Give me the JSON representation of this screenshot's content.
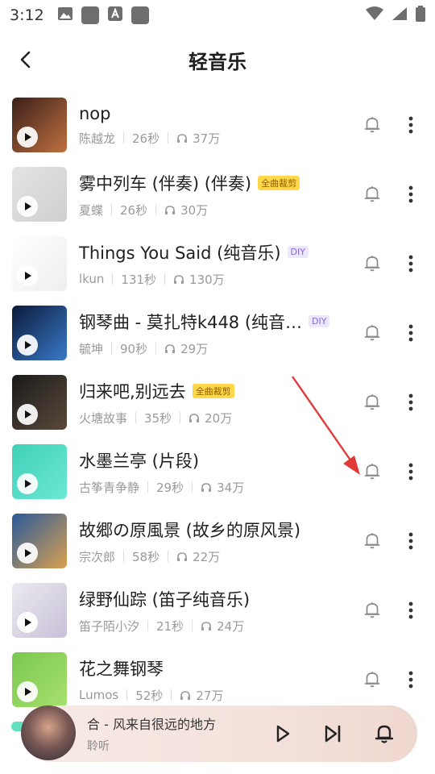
{
  "status_bar": {
    "time": "3:12"
  },
  "header": {
    "title": "轻音乐"
  },
  "songs": [
    {
      "title": "nop",
      "artist": "陈越龙",
      "duration": "26秒",
      "plays": "37万",
      "badge": "",
      "cover": [
        "#3a1f18",
        "#c07040"
      ]
    },
    {
      "title": "雾中列车 (伴奏) (伴奏)",
      "artist": "夏蝶",
      "duration": "26秒",
      "plays": "30万",
      "badge": "全曲裁剪",
      "cover": [
        "#e4e4e4",
        "#cfcfcf"
      ]
    },
    {
      "title": "Things You Said (纯音乐)",
      "artist": "lkun",
      "duration": "131秒",
      "plays": "130万",
      "badge": "DIY",
      "cover": [
        "#ffffff",
        "#eeeeee"
      ]
    },
    {
      "title": "钢琴曲 - 莫扎特k448 (纯音…",
      "artist": "毓坤",
      "duration": "90秒",
      "plays": "29万",
      "badge": "DIY",
      "cover": [
        "#0a1a3a",
        "#3a7ac8"
      ]
    },
    {
      "title": "归来吧,别远去",
      "artist": "火塘故事",
      "duration": "35秒",
      "plays": "20万",
      "badge": "全曲裁剪",
      "cover": [
        "#1a1a1a",
        "#5a4a3a"
      ]
    },
    {
      "title": "水墨兰亭 (片段)",
      "artist": "古筝青争静",
      "duration": "29秒",
      "plays": "34万",
      "badge": "",
      "cover": [
        "#3fd0b8",
        "#6ce8d4"
      ]
    },
    {
      "title": "故郷の原風景 (故乡的原风景)",
      "artist": "宗次郎",
      "duration": "58秒",
      "plays": "22万",
      "badge": "",
      "cover": [
        "#2a5a9a",
        "#d8a050"
      ]
    },
    {
      "title": "绿野仙踪 (笛子纯音乐)",
      "artist": "笛子陌小汐",
      "duration": "21秒",
      "plays": "24万",
      "badge": "",
      "cover": [
        "#eceaf0",
        "#c8c0d8"
      ]
    },
    {
      "title": "花之舞钢琴",
      "artist": "Lumos",
      "duration": "52秒",
      "plays": "27万",
      "badge": "",
      "cover": [
        "#7ac850",
        "#a8e070"
      ]
    }
  ],
  "player": {
    "song": "合 - 风来自很远的地方",
    "artist": "聆听"
  },
  "colors": {
    "badge_gold": "#ffd84a",
    "badge_diy": "#ece6ff",
    "arrow": "#e03a3a"
  }
}
